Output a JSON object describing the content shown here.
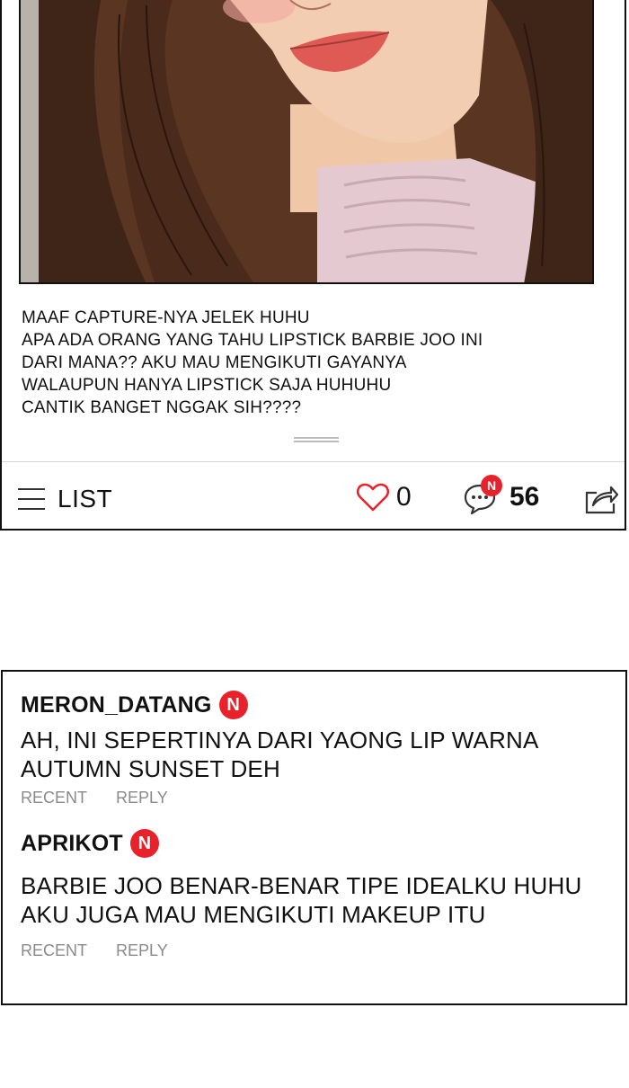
{
  "post": {
    "text_lines": [
      "MAAF CAPTURE-NYA JELEK HUHU",
      "APA ADA ORANG YANG TAHU LIPSTICK BARBIE JOO INI",
      "DARI MANA?? AKU MAU MENGIKUTI GAYANYA",
      "WALAUPUN HANYA LIPSTICK SAJA HUHUHU",
      "CANTIK BANGET NGGAK SIH????"
    ]
  },
  "action_bar": {
    "list_label": "LIST",
    "like_count": "0",
    "comment_count": "56",
    "new_badge": "N",
    "icons": {
      "list": "hamburger-icon",
      "like": "heart-icon",
      "comment": "comment-bubble-icon",
      "share": "share-icon"
    }
  },
  "comments": [
    {
      "username": "MERON_DATANG",
      "badge": "N",
      "lines": [
        "AH, INI SEPERTINYA DARI YAONG LIP WARNA",
        "AUTUMN SUNSET DEH"
      ],
      "recent_label": "RECENT",
      "reply_label": "REPLY"
    },
    {
      "username": "APRIKOT",
      "badge": "N",
      "lines": [
        "BARBIE JOO BENAR-BENAR TIPE IDEALKU HUHU",
        "AKU JUGA MAU MENGIKUTI MAKEUP ITU"
      ],
      "recent_label": "RECENT",
      "reply_label": "REPLY"
    }
  ],
  "colors": {
    "badge_red": "#e8212b",
    "like_red": "#e8212b",
    "meta_gray": "#8a8a8a",
    "border": "#111111"
  }
}
